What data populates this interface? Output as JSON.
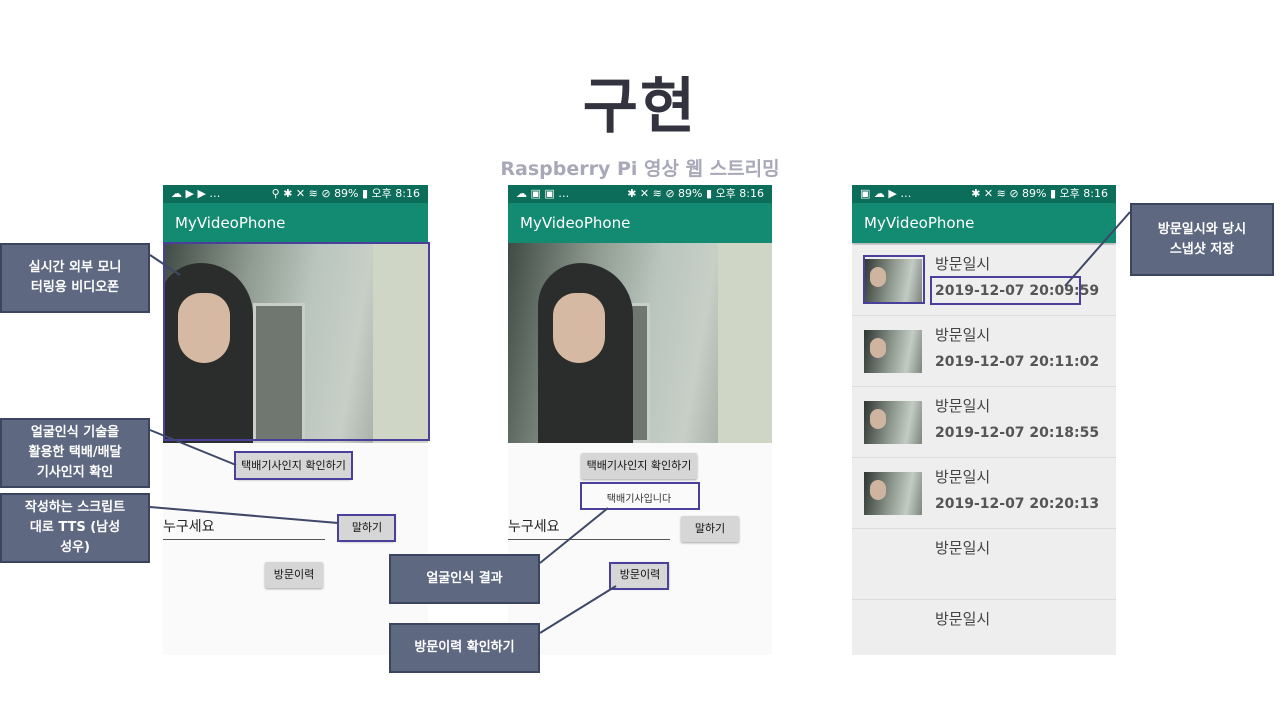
{
  "slide": {
    "title": "구현",
    "subtitle": "Raspberry Pi 영상  웹  스트리밍"
  },
  "status_bar": {
    "left_1": "☁ ▶ ▶ …",
    "left_2": "☁ ▣ ▣ …",
    "left_3": "▣ ☁ ▶ …",
    "right_1": "⚲ ✱ ✕ ≋ ⊘ 89% ▮ 오후 8:16",
    "right_2": "✱ ✕ ≋ ⊘ 89% ▮ 오후 8:16",
    "right_3": "✱ ✕ ≋ ⊘ 89% ▮ 오후 8:16"
  },
  "app": {
    "title": "MyVideoPhone"
  },
  "screen1": {
    "check_courier_button": "택배기사인지 확인하기",
    "text_input_value": "누구세요",
    "speak_button": "말하기",
    "history_button": "방문이력"
  },
  "screen2": {
    "check_courier_button": "택배기사인지 확인하기",
    "result_text": "택배기사입니다",
    "text_input_value": "누구세요",
    "speak_button": "말하기",
    "history_button": "방문이력"
  },
  "visit_history": {
    "items": [
      {
        "title": "방문일시",
        "date": "2019-12-07 20:09:59"
      },
      {
        "title": "방문일시",
        "date": "2019-12-07 20:11:02"
      },
      {
        "title": "방문일시",
        "date": "2019-12-07 20:18:55"
      },
      {
        "title": "방문일시",
        "date": "2019-12-07 20:20:13"
      },
      {
        "title": "방문일시",
        "date": ""
      },
      {
        "title": "방문일시",
        "date": ""
      }
    ]
  },
  "callouts": {
    "live_monitor": "실시간 외부 모니\n터링용 비디오폰",
    "face_recognition": "얼굴인식 기술을\n활용한 택배/배달\n기사인지 확인",
    "tts": "작성하는 스크립트\n대로 TTS (남성\n성우)",
    "face_result": "얼굴인식 결과",
    "history_check": "방문이력 확인하기",
    "snapshot": "방문일시와 당시\n스냅샷 저장"
  },
  "colors": {
    "status_bar": "#0c6e5a",
    "app_bar": "#138a72",
    "callout_bg": "#5e6880",
    "highlight_border": "#4a3f9a"
  }
}
